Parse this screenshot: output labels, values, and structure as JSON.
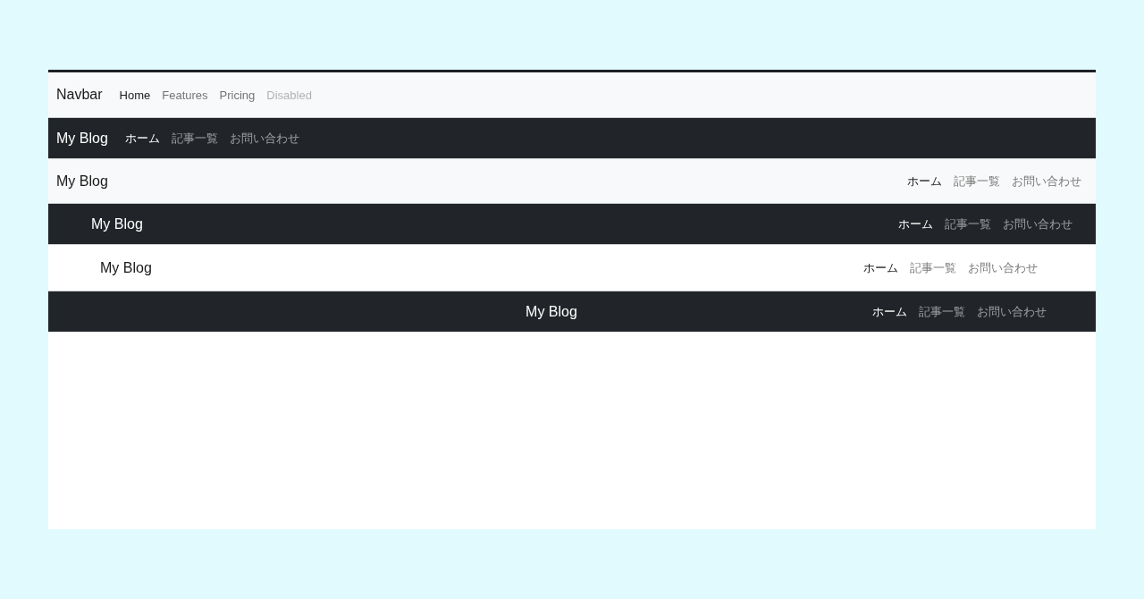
{
  "navbars": [
    {
      "color": "#f8f9fa",
      "kind": "start",
      "brand": "Navbar",
      "links": [
        {
          "label": "Home",
          "selected": true,
          "disabled": false
        },
        {
          "label": "Features",
          "selected": false,
          "disabled": false
        },
        {
          "label": "Pricing",
          "selected": false,
          "disabled": false
        },
        {
          "label": "Disabled",
          "selected": false,
          "disabled": true
        }
      ]
    },
    {
      "color": "#212529",
      "kind": "start",
      "brand": "My Blog",
      "links": [
        {
          "label": "ホーム",
          "selected": true
        },
        {
          "label": "記事一覧",
          "selected": false
        },
        {
          "label": "お問い合わせ",
          "selected": false
        }
      ]
    },
    {
      "color": "#f8f9fa",
      "kind": "split",
      "brand": "My Blog",
      "links": [
        {
          "label": "ホーム",
          "selected": true
        },
        {
          "label": "記事一覧",
          "selected": false
        },
        {
          "label": "お問い合わせ",
          "selected": false
        }
      ]
    },
    {
      "color": "#212529",
      "kind": "inset",
      "brand": "My Blog",
      "links": [
        {
          "label": "ホーム",
          "selected": true
        },
        {
          "label": "記事一覧",
          "selected": false
        },
        {
          "label": "お問い合わせ",
          "selected": false
        }
      ]
    },
    {
      "color": "#ffffff",
      "kind": "container",
      "brand": "My Blog",
      "links": [
        {
          "label": "ホーム",
          "selected": true
        },
        {
          "label": "記事一覧",
          "selected": false
        },
        {
          "label": "お問い合わせ",
          "selected": false
        }
      ]
    },
    {
      "color": "#212529",
      "kind": "centered",
      "brand": "My Blog",
      "links": [
        {
          "label": "ホーム",
          "selected": true
        },
        {
          "label": "記事一覧",
          "selected": false
        },
        {
          "label": "お問い合わせ",
          "selected": false
        }
      ]
    }
  ]
}
